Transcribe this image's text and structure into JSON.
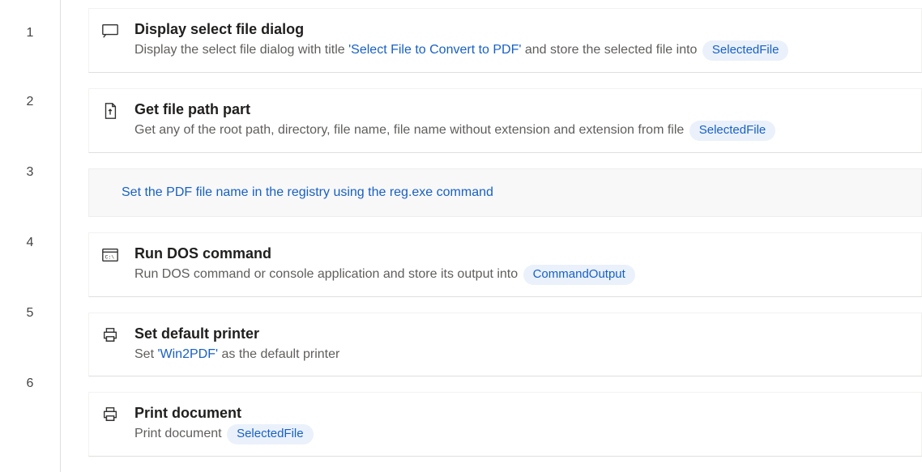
{
  "steps": [
    {
      "number": "1",
      "title": "Display select file dialog",
      "desc_prefix": "Display the select file dialog with title ",
      "literal": "'Select File to Convert to PDF'",
      "desc_mid": " and store the selected file into ",
      "variable": "SelectedFile"
    },
    {
      "number": "2",
      "title": "Get file path part",
      "desc_prefix": "Get any of the root path, directory, file name, file name without extension and extension from file ",
      "variable": "SelectedFile"
    },
    {
      "number": "3",
      "comment": "Set the PDF file name in the registry using the reg.exe command"
    },
    {
      "number": "4",
      "title": "Run DOS command",
      "desc_prefix": "Run DOS command or console application and store its output into ",
      "variable": "CommandOutput"
    },
    {
      "number": "5",
      "title": "Set default printer",
      "desc_prefix": "Set ",
      "literal": "'Win2PDF'",
      "desc_suffix": " as the default printer"
    },
    {
      "number": "6",
      "title": "Print document",
      "desc_prefix": "Print document ",
      "variable": "SelectedFile"
    }
  ]
}
